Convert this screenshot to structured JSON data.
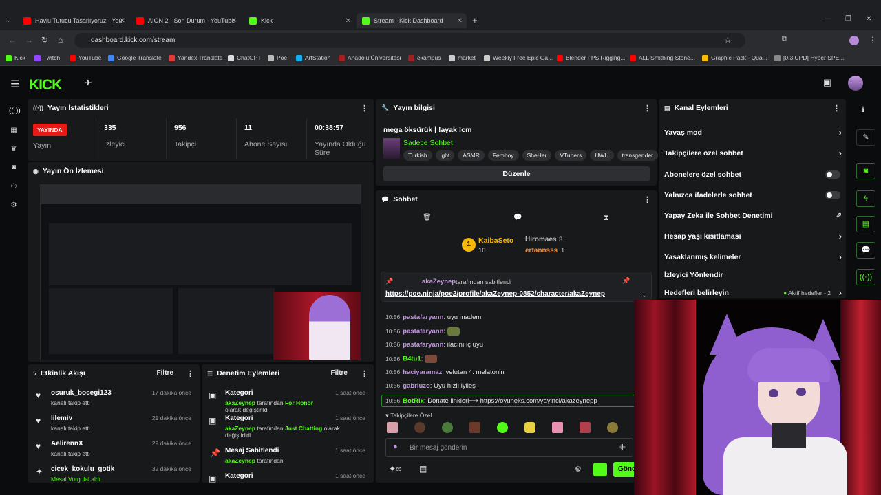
{
  "browser": {
    "tabs": [
      {
        "title": "Havlu Tutucu Tasarlıyoruz - You",
        "icon": "youtube-icon"
      },
      {
        "title": "AION 2 - Son Durum - YouTube",
        "icon": "youtube-icon"
      },
      {
        "title": "Kick",
        "icon": "kick-icon"
      },
      {
        "title": "Stream - Kick Dashboard",
        "icon": "kick-icon"
      }
    ],
    "url": "dashboard.kick.com/stream",
    "bookmarks": [
      "Kick",
      "Twitch",
      "YouTube",
      "Google Translate",
      "Yandex Translate",
      "ChatGPT",
      "Poe",
      "ArtStation",
      "Anadolu Üniversitesi",
      "ekampüs",
      "market",
      "Weekly Free Epic Ga...",
      "Blender FPS Rigging...",
      "ALL Smithing Stone...",
      "Graphic Pack - Qua...",
      "[0.3 UPD] Hyper SPE..."
    ]
  },
  "colors": {
    "brand": "#53fc18",
    "live": "#e91916",
    "panel": "#18191b",
    "bg": "#0b0c0e"
  },
  "stats": {
    "title": "Yayın İstatistikleri",
    "live_badge": "YAYINDA",
    "live_label": "Yayın",
    "viewers": "335",
    "viewers_label": "İzleyici",
    "followers": "956",
    "followers_label": "Takipçi",
    "subs": "11",
    "subs_label": "Abone Sayısı",
    "uptime": "00:38:57",
    "uptime_label": "Yayında Olduğu Süre"
  },
  "preview": {
    "title": "Yayın Ön İzlemesi"
  },
  "stream_info": {
    "title": "Yayın bilgisi",
    "stream_title": "mega öksürük | !ayak !cm",
    "category": "Sadece Sohbet",
    "tags": [
      "Turkish",
      "lgbt",
      "ASMR",
      "Femboy",
      "SheHer",
      "VTubers",
      "UWU",
      "transgender"
    ],
    "edit_button": "Düzenle"
  },
  "chat": {
    "title": "Sohbet",
    "leaderboard": [
      {
        "rank": "1",
        "name": "KaibaSeto",
        "count": "10"
      },
      {
        "name": "Hiromaes",
        "count": "3"
      },
      {
        "name": "ertannsss",
        "count": "1"
      }
    ],
    "pinned_by": "akaZeynep",
    "pinned_suffix": "tarafından sabitlendi",
    "pinned_link": "https://poe.ninja/poe2/profile/akaZeynep-0852/character/akaZeynep",
    "messages": [
      {
        "time": "10:56",
        "user": "pastafaryann",
        "text": "uyu madem",
        "color": "#c792ea"
      },
      {
        "time": "10:56",
        "user": "pastafaryann",
        "text": "",
        "color": "#c792ea"
      },
      {
        "time": "10:56",
        "user": "pastafaryann",
        "text": "ilacını iç uyu",
        "color": "#c792ea"
      },
      {
        "time": "10:56",
        "user": "B4tu1",
        "text": "",
        "color": "#53fc18"
      },
      {
        "time": "10:56",
        "user": "haciyaramaz",
        "text": "velutan 4. melatonin",
        "color": "#c792ea"
      },
      {
        "time": "10:56",
        "user": "gabriuzo",
        "text": "Uyu hızlı iyileş",
        "color": "#c792ea"
      },
      {
        "time": "10:56",
        "user": "BotRix",
        "text": "Donate linkleri⟶",
        "link": "https://oyuneks.com/yayinci/akazeynepp",
        "color": "#53fc18"
      }
    ],
    "followers_only_label": "Takipçilere Özel",
    "input_placeholder": "Bir mesaj gönderin",
    "send_button": "Gönd"
  },
  "channel_actions": {
    "title": "Kanal Eylemleri",
    "items": [
      {
        "label": "Yavaş mod",
        "type": "chevron"
      },
      {
        "label": "Takipçilere özel sohbet",
        "type": "chevron"
      },
      {
        "label": "Abonelere özel sohbet",
        "type": "toggle"
      },
      {
        "label": "Yalnızca ifadelerle sohbet",
        "type": "toggle"
      },
      {
        "label": "Yapay Zeka ile Sohbet Denetimi",
        "type": "external"
      },
      {
        "label": "Hesap yaşı kısıtlaması",
        "type": "chevron"
      },
      {
        "label": "Yasaklanmış kelimeler",
        "type": "chevron"
      },
      {
        "label": "İzleyici Yönlendir",
        "type": "none"
      },
      {
        "label": "Hedefleri belirleyin",
        "type": "chevron",
        "status": "Aktif hedefler - 2"
      }
    ]
  },
  "activity": {
    "title": "Etkinlik Akışı",
    "filter": "Filtre",
    "items": [
      {
        "user": "osuruk_bocegi123",
        "action": "kanalı takip etti",
        "time": "17 dakika önce"
      },
      {
        "user": "lilemiv",
        "action": "kanalı takip etti",
        "time": "21 dakika önce"
      },
      {
        "user": "AelirennX",
        "action": "kanalı takip etti",
        "time": "29 dakika önce"
      },
      {
        "user": "cicek_kokulu_gotik",
        "action": "Mesai Vurgulal aldı",
        "time": "32 dakika önce"
      }
    ]
  },
  "moderation": {
    "title": "Denetim Eylemleri",
    "filter": "Filtre",
    "items": [
      {
        "title": "Kategori",
        "user": "akaZeynep",
        "mid": "tarafından",
        "value": "For Honor",
        "end": "olarak değiştirildi",
        "time": "1 saat önce"
      },
      {
        "title": "Kategori",
        "user": "akaZeynep",
        "mid": "tarafından",
        "value": "Just Chatting",
        "end": "olarak değiştirildi",
        "time": "1 saat önce"
      },
      {
        "title": "Mesaj Sabitlendi",
        "user": "akaZeynep",
        "mid": "tarafından",
        "value": "",
        "end": "",
        "time": "1 saat önce"
      },
      {
        "title": "Kategori",
        "user": "",
        "mid": "",
        "value": "",
        "end": "",
        "time": "1 saat önce"
      }
    ]
  }
}
